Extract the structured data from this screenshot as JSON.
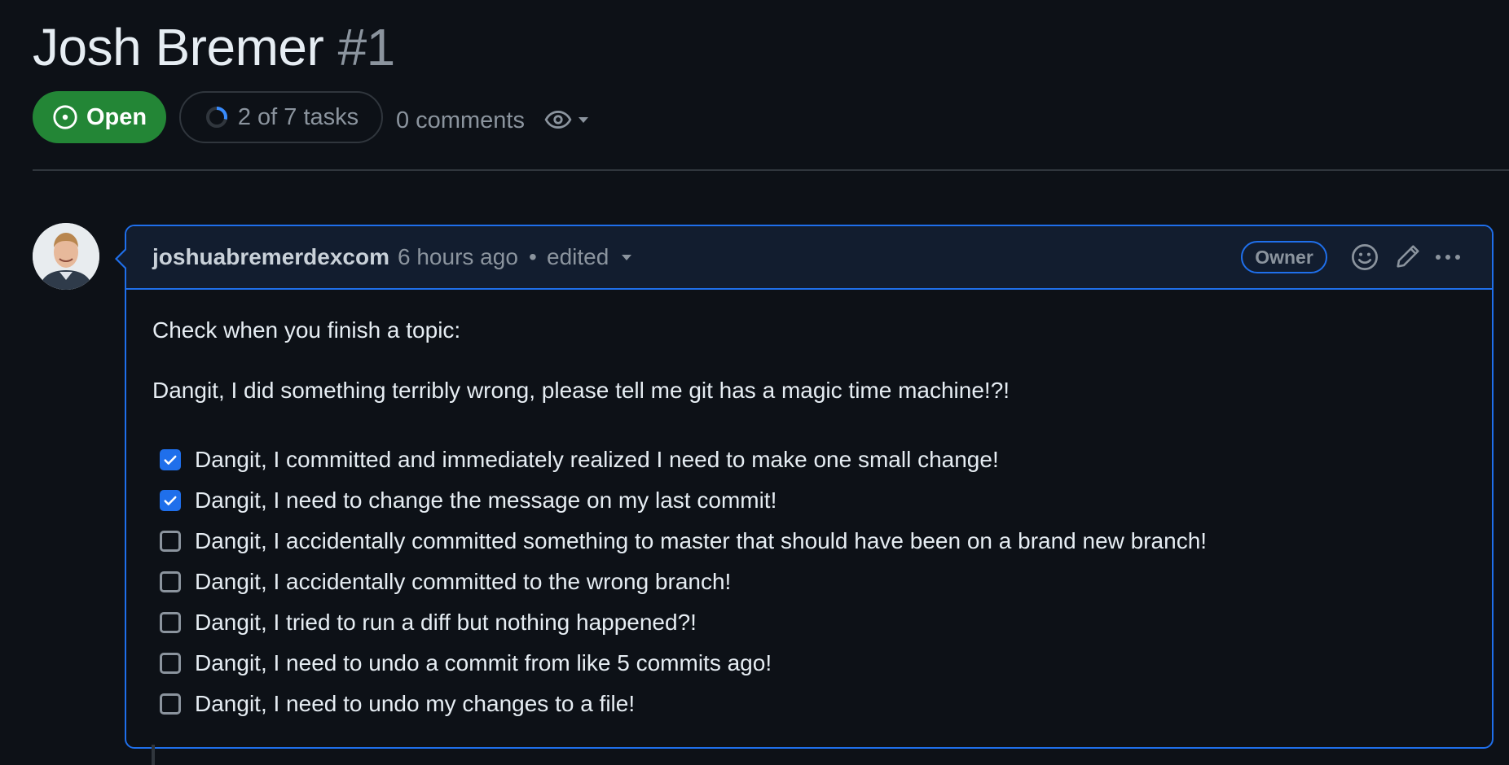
{
  "issue": {
    "title": "Josh Bremer",
    "number": "#1",
    "state": "Open",
    "tasks_summary": "2 of 7 tasks",
    "tasks_progress": 0.2857,
    "comments_count": "0 comments"
  },
  "comment": {
    "author": "joshuabremerdexcom",
    "timestamp": "6 hours ago",
    "separator": "•",
    "edited_label": "edited",
    "role_badge": "Owner",
    "body": {
      "intro": "Check when you finish a topic:",
      "heading": "Dangit, I did something terribly wrong, please tell me git has a magic time machine!?!",
      "tasks": [
        {
          "label": "Dangit, I committed and immediately realized I need to make one small change!",
          "checked": true
        },
        {
          "label": "Dangit, I need to change the message on my last commit!",
          "checked": true
        },
        {
          "label": "Dangit, I accidentally committed something to master that should have been on a brand new branch!",
          "checked": false
        },
        {
          "label": "Dangit, I accidentally committed to the wrong branch!",
          "checked": false
        },
        {
          "label": "Dangit, I tried to run a diff but nothing happened?!",
          "checked": false
        },
        {
          "label": "Dangit, I need to undo a commit from like 5 commits ago!",
          "checked": false
        },
        {
          "label": "Dangit, I need to undo my changes to a file!",
          "checked": false
        }
      ]
    }
  },
  "icons": {
    "state": "issue-opened-icon",
    "progress": "progress-ring-icon",
    "watch": "eye-icon",
    "dropdown": "triangle-down-icon",
    "reaction": "smiley-icon",
    "edit": "pencil-icon",
    "more": "kebab-horizontal-icon",
    "check": "check-icon"
  },
  "colors": {
    "background": "#0d1117",
    "open_green": "#238636",
    "accent_blue": "#1f6feb",
    "muted_text": "#8b949e",
    "border": "#30363d",
    "header_bg": "#121d2f"
  }
}
